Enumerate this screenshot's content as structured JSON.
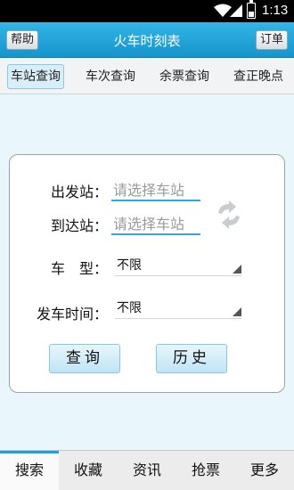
{
  "status_bar": {
    "time": "1:13"
  },
  "header": {
    "help_label": "帮助",
    "title": "火车时刻表",
    "orders_label": "订单"
  },
  "tabs": [
    {
      "label": "车站查询"
    },
    {
      "label": "车次查询"
    },
    {
      "label": "余票查询"
    },
    {
      "label": "查正晚点"
    }
  ],
  "form": {
    "departure_label": "出发站：",
    "departure_placeholder": "请选择车站",
    "arrival_label": "到达站：",
    "arrival_placeholder": "请选择车站",
    "train_type_label": "车　型：",
    "train_type_value": "不限",
    "depart_time_label": "发车时间：",
    "depart_time_value": "不限",
    "search_label": "查询",
    "history_label": "历史"
  },
  "bottom_nav": [
    {
      "label": "搜索"
    },
    {
      "label": "收藏"
    },
    {
      "label": "资讯"
    },
    {
      "label": "抢票"
    },
    {
      "label": "更多"
    }
  ],
  "colors": {
    "accent": "#1aa3dd",
    "header": "#33b5e5",
    "background": "#e9f7fd"
  }
}
